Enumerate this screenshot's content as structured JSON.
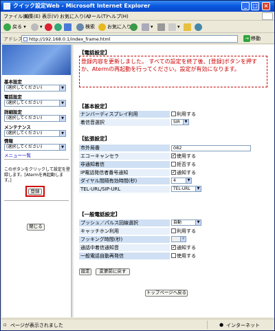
{
  "window": {
    "title": "クイック設定Web - Microsoft Internet Explorer"
  },
  "menubar": {
    "items": [
      "ファイル(F)",
      "編集(E)",
      "表示(V)",
      "お気に入り(A)",
      "ツール(T)",
      "ヘルプ(H)"
    ]
  },
  "toolbar": {
    "back": "戻る",
    "search": "検索",
    "favorites": "お気に入り"
  },
  "address": {
    "label": "アドレス(D)",
    "url": "http://192.168.0.1/index_frame.html",
    "go": "移動"
  },
  "sidebar": {
    "groups": [
      {
        "label": "基本設定",
        "select": "(選択してください)"
      },
      {
        "label": "電話設定",
        "select": "(選択してください)"
      },
      {
        "label": "詳細設定",
        "select": "(選択してください)"
      },
      {
        "label": "メンテナンス",
        "select": "(選択してください)"
      },
      {
        "label": "情報",
        "select": "(選択してください)"
      }
    ],
    "menu_list": "メニュー一覧",
    "hint": "このボタンをクリックして設定を登録します。[Atermを再起動します。]",
    "register": "登録",
    "close": "閉じる"
  },
  "main": {
    "title": "【電話設定】",
    "notice": "登録内容を更新しました。 すべての設定を終了後、[登録]ボタンを押すか、Atermの再起動を行ってください。設定が有効になります。",
    "sections": [
      {
        "heading": "【基本設定】",
        "rows": [
          {
            "label": "ナンバーディスプレイ利用",
            "type": "checkbox",
            "checked": false,
            "text": "利用する"
          },
          {
            "label": "着信音選択",
            "type": "select",
            "value": "SIR"
          }
        ]
      },
      {
        "heading": "【拡張設定】",
        "rows": [
          {
            "label": "市外局番",
            "type": "text",
            "value": "082"
          },
          {
            "label": "エコーキャンセラ",
            "type": "checkbox",
            "checked": true,
            "text": "使用する"
          },
          {
            "label": "非通知着信",
            "type": "checkbox",
            "checked": false,
            "text": "拒否する"
          },
          {
            "label": "IP電話発信者番号通知",
            "type": "checkbox",
            "checked": true,
            "text": "通知する"
          },
          {
            "label": "ダイヤル間隔有効時間(秒)",
            "type": "select",
            "value": "4"
          },
          {
            "label": "TEL-URL/SIP-URL",
            "type": "select",
            "value": "TEL-URL"
          }
        ]
      },
      {
        "heading": "【一般電話設定】",
        "rows": [
          {
            "label": "プッシュ／パルス回線選択",
            "type": "select",
            "value": "自動"
          },
          {
            "label": "キャッチホン利用",
            "type": "checkbox",
            "checked": false,
            "text": "利用する"
          },
          {
            "label": "フッキング時間(秒)",
            "type": "select",
            "value": "",
            "disabled": true
          },
          {
            "label": "通話中着信通知音",
            "type": "checkbox",
            "checked": true,
            "text": "通知する"
          },
          {
            "label": "一般電話自動再発信",
            "type": "checkbox",
            "checked": false,
            "text": "使用する"
          }
        ]
      }
    ],
    "buttons": {
      "set": "設定",
      "revert": "変更前に戻す",
      "top": "トップページへ戻る"
    }
  },
  "status": {
    "text": "ページが表示されました",
    "zone": "インターネット"
  },
  "colors": {
    "titlebar": "#0a5ae0",
    "notice": "#cc0000",
    "label_bg": "#cfe0f4"
  }
}
